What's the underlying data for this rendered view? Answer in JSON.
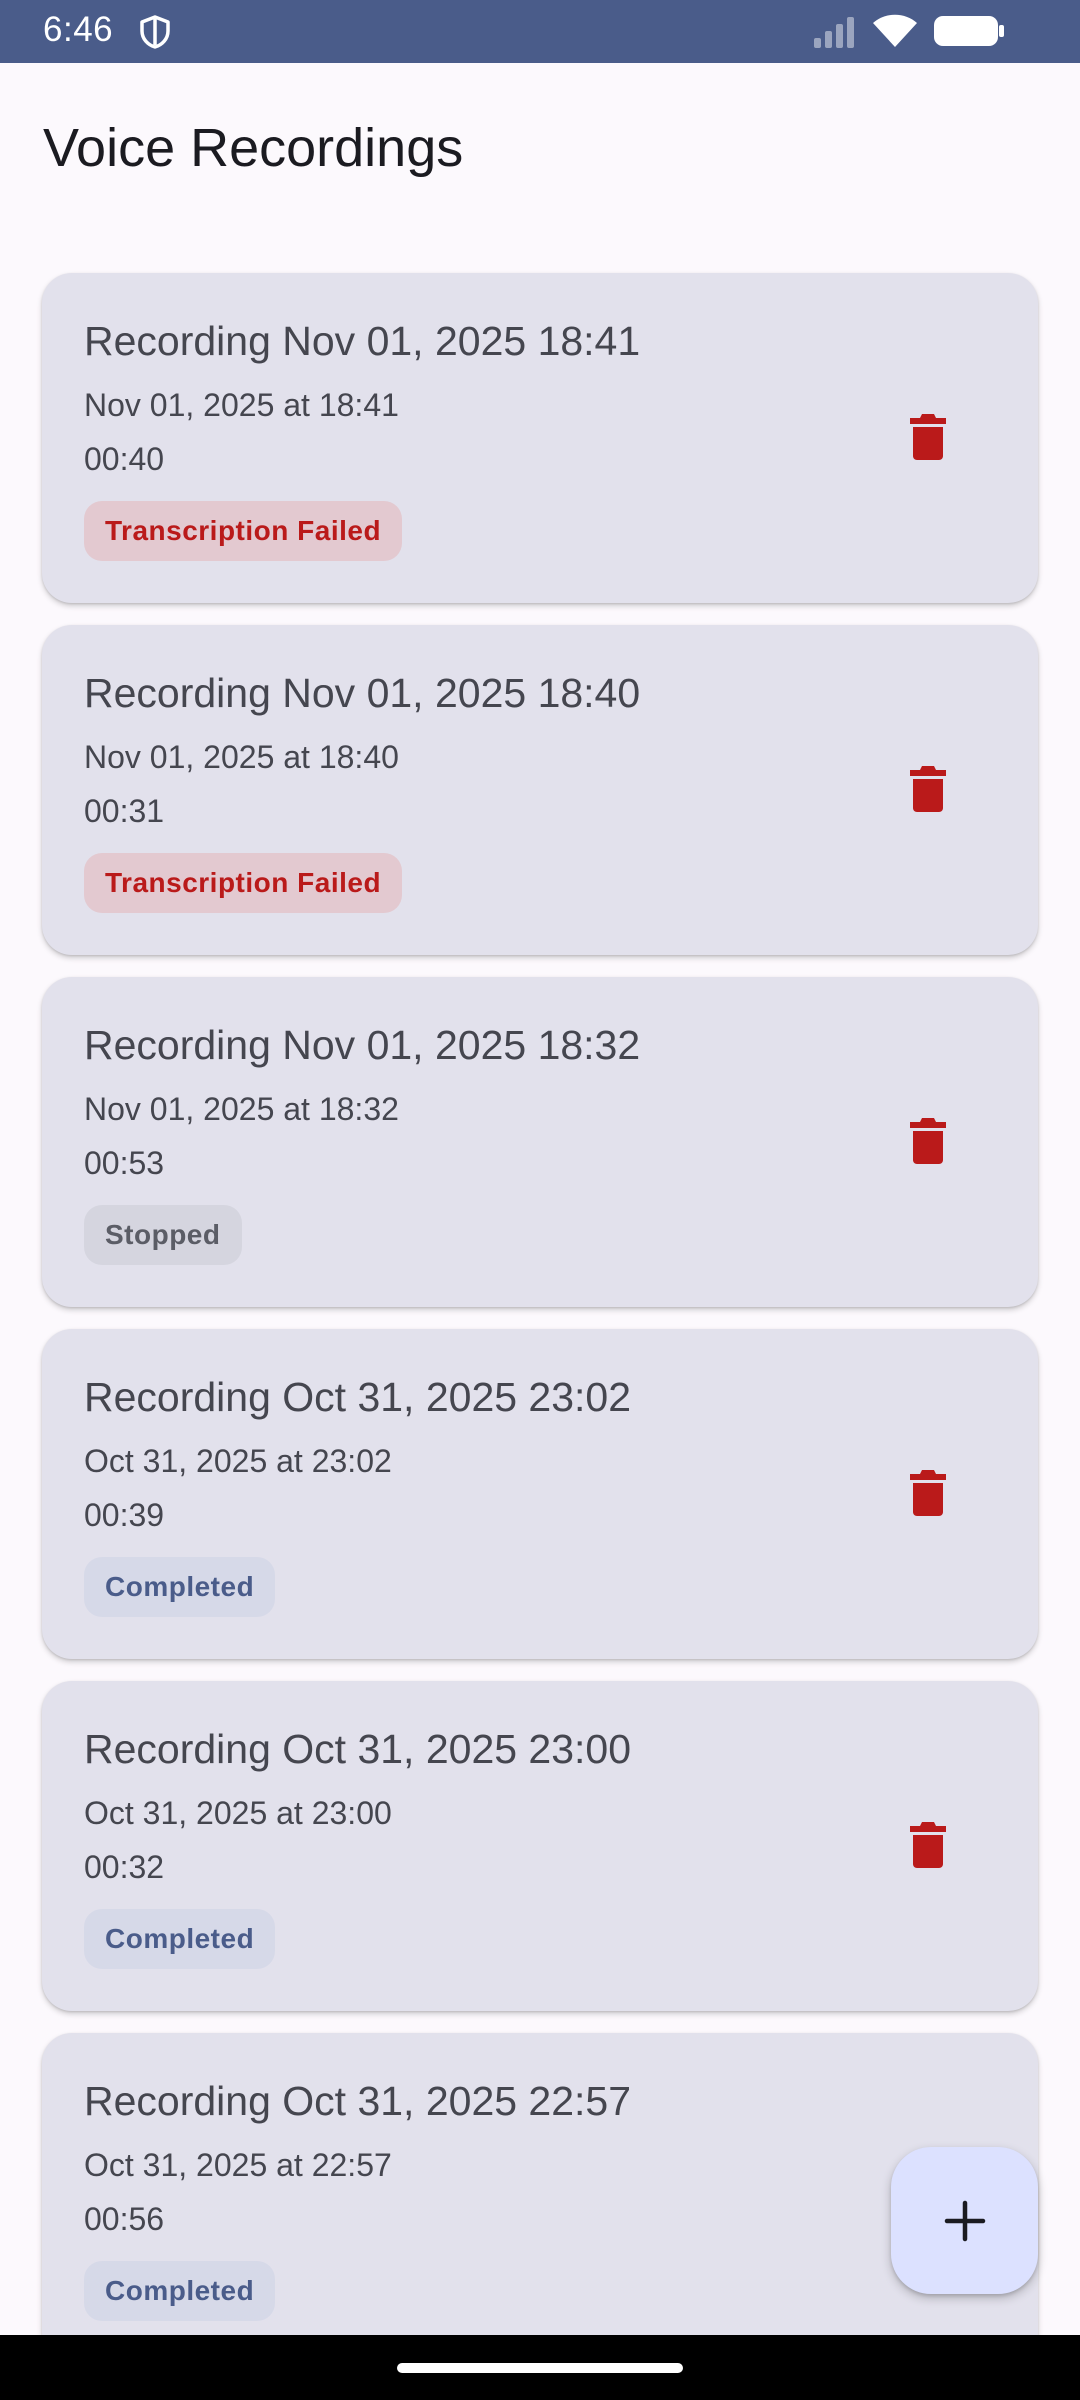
{
  "status_bar": {
    "time": "6:46",
    "icons": [
      "shield-icon",
      "signal-icon",
      "wifi-icon",
      "battery-icon"
    ],
    "background": "#4a5c8a"
  },
  "header": {
    "title": "Voice Recordings"
  },
  "recordings": [
    {
      "title": "Recording Nov 01, 2025 18:41",
      "date": "Nov 01, 2025 at 18:41",
      "duration": "00:40",
      "status": "Transcription Failed",
      "status_type": "failed"
    },
    {
      "title": "Recording Nov 01, 2025 18:40",
      "date": "Nov 01, 2025 at 18:40",
      "duration": "00:31",
      "status": "Transcription Failed",
      "status_type": "failed"
    },
    {
      "title": "Recording Nov 01, 2025 18:32",
      "date": "Nov 01, 2025 at 18:32",
      "duration": "00:53",
      "status": "Stopped",
      "status_type": "stopped"
    },
    {
      "title": "Recording Oct 31, 2025 23:02",
      "date": "Oct 31, 2025 at 23:02",
      "duration": "00:39",
      "status": "Completed",
      "status_type": "completed"
    },
    {
      "title": "Recording Oct 31, 2025 23:00",
      "date": "Oct 31, 2025 at 23:00",
      "duration": "00:32",
      "status": "Completed",
      "status_type": "completed"
    },
    {
      "title": "Recording Oct 31, 2025 22:57",
      "date": "Oct 31, 2025 at 22:57",
      "duration": "00:56",
      "status": "Completed",
      "status_type": "completed"
    }
  ],
  "fab": {
    "icon": "plus-icon"
  },
  "colors": {
    "card_background": "#e2e1ec",
    "delete_icon": "#ba1a1a",
    "failed_badge_bg": "#e3c9d0",
    "failed_badge_text": "#ba1a1a",
    "stopped_badge_bg": "#d5d5df",
    "stopped_badge_text": "#5b5d66",
    "completed_badge_bg": "#d6d9e8",
    "completed_badge_text": "#4a5c8a",
    "fab_background": "#dce1ff"
  }
}
